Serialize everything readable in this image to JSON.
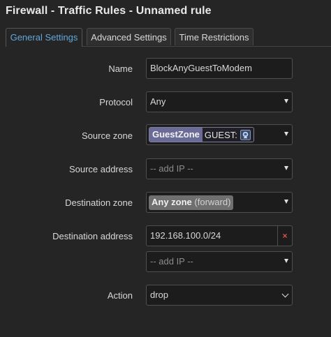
{
  "title": "Firewall - Traffic Rules - Unnamed rule",
  "tabs": [
    {
      "label": "General Settings",
      "active": true
    },
    {
      "label": "Advanced Settings",
      "active": false
    },
    {
      "label": "Time Restrictions",
      "active": false
    }
  ],
  "form": {
    "name": {
      "label": "Name",
      "value": "BlockAnyGuestToModem"
    },
    "protocol": {
      "label": "Protocol",
      "value": "Any"
    },
    "source_zone": {
      "label": "Source zone",
      "zone": "GuestZone",
      "device": "GUEST:",
      "device_icon": "wifi-icon"
    },
    "source_address": {
      "label": "Source address",
      "placeholder": "-- add IP --"
    },
    "destination_zone": {
      "label": "Destination zone",
      "zone": "Any zone",
      "suffix": "(forward)"
    },
    "destination_address": {
      "label": "Destination address",
      "value": "192.168.100.0/24",
      "remove_label": "×",
      "add_placeholder": "-- add IP --"
    },
    "action": {
      "label": "Action",
      "value": "drop"
    }
  },
  "colors": {
    "background": "#252526",
    "active_tab_text": "#62a8d9",
    "zone_chip": "#6b6b98",
    "remove_button": "#d9534f"
  }
}
